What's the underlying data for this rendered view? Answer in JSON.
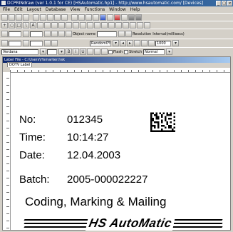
{
  "window": {
    "title": "DCPRINdraw (ver 1.0.1 for CE) [HSAutomatic.hp1] - http://www.hsautomatic.com/ [Devices]"
  },
  "menu": [
    "File",
    "Edit",
    "Layout",
    "Database",
    "View",
    "Functions",
    "Window",
    "Help"
  ],
  "toolbar": {
    "object_name_label": "Object name",
    "rotation_field": "Random0%",
    "resolution_label": "Resolution",
    "interval_label": "Interval(millisecs)",
    "interval_value": "1000",
    "font_value": "Verdana",
    "flash_label": "Flash",
    "stretch_label": "Stretch",
    "style_value": "Normal"
  },
  "document": {
    "title": "Label File - C:\\Users\\Hsmarker.hsk",
    "tab_label": "DOTV Label"
  },
  "label": {
    "no_label": "No:",
    "no_value": "012345",
    "time_label": "Time:",
    "time_value": "10:14:27",
    "date_label": "Date:",
    "date_value": "12.04.2003",
    "batch_label": "Batch:",
    "batch_value": "2005-000022227",
    "slogan": "Coding, Marking & Mailing",
    "logo_text": "HS AutoMatic"
  }
}
